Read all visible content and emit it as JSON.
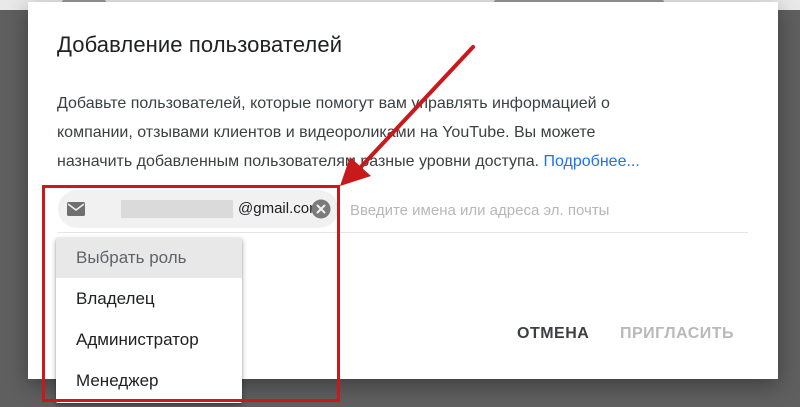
{
  "dialog": {
    "title": "Добавление пользователей",
    "description_lines": [
      "Добавьте пользователей, которые помогут вам управлять информацией о",
      "компании, отзывами клиентов и видеороликами на YouTube. Вы можете",
      "назначить добавленным пользователям разные уровни доступа. "
    ],
    "learn_more_link": "Подробнее...",
    "chip": {
      "email_domain": "@gmail.com",
      "icon": "mail-icon",
      "remove_icon": "close-circle-icon"
    },
    "input_placeholder": "Введите имена или адреса эл. почты",
    "role_menu": {
      "header": "Выбрать роль",
      "items": [
        "Владелец",
        "Администратор",
        "Менеджер"
      ]
    },
    "buttons": {
      "cancel": "ОТМЕНА",
      "invite": "ПРИГЛАСИТЬ"
    }
  },
  "colors": {
    "link": "#1a73e8",
    "annotation": "#c8191c",
    "disabled_button": "#b9b9b9"
  }
}
